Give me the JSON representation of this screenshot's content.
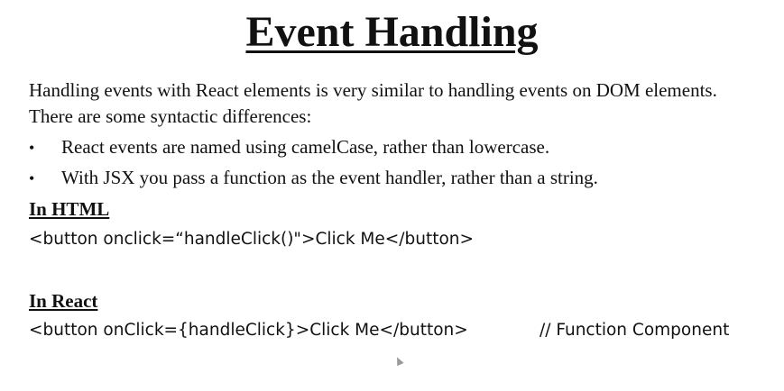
{
  "slide": {
    "title": "Event Handling",
    "intro": "Handling events with React elements is very similar to handling events on DOM elements. There are some syntactic differences:",
    "bullet_char": "•",
    "bullets": [
      "React events are named using camelCase, rather than lowercase.",
      "With JSX you pass a function as the event handler, rather than a string."
    ],
    "html_section": {
      "heading": "In HTML",
      "code": "<button onclick=“handleClick()\">Click Me</button>"
    },
    "react_section": {
      "heading": "In React",
      "code": "<button onClick={handleClick}>Click Me</button>",
      "comment": "// Function Component"
    }
  }
}
